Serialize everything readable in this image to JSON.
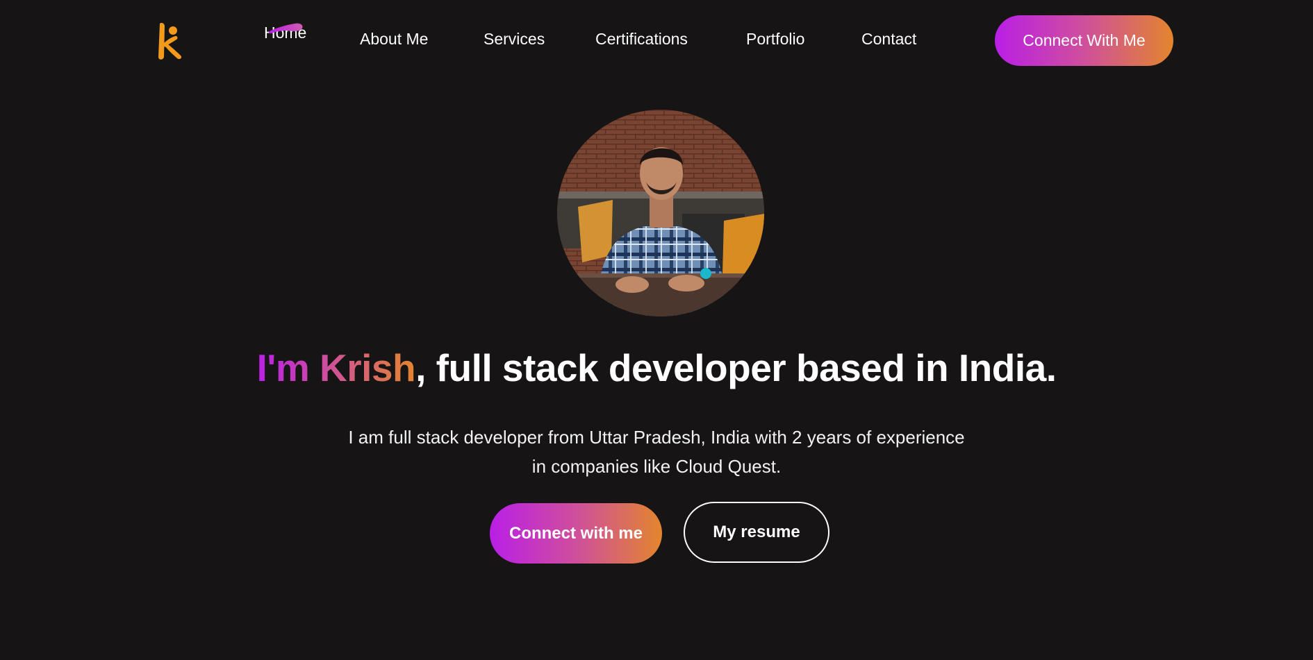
{
  "nav": {
    "logo_icon": "k-person-logo-icon",
    "items": [
      {
        "label": "Home",
        "active": true
      },
      {
        "label": "About Me"
      },
      {
        "label": "Services"
      },
      {
        "label": "Certifications"
      },
      {
        "label": "Portfolio"
      },
      {
        "label": "Contact"
      }
    ],
    "cta_label": "Connect With Me"
  },
  "hero": {
    "avatar_icon": "profile-photo",
    "headline_highlight": "I'm Krish",
    "headline_rest": ", full stack developer based in India.",
    "subtext_line1": "I am full stack developer from Uttar Pradesh, India with 2 years of experience",
    "subtext_line2": "in companies like Cloud Quest.",
    "primary_button": "Connect with me",
    "secondary_button": "My resume"
  },
  "colors": {
    "background": "#161414",
    "gradient_start": "#b91fe6",
    "gradient_mid": "#cf4f9c",
    "gradient_end": "#e3852d",
    "logo_orange": "#f39a1d",
    "text": "#ffffff"
  }
}
